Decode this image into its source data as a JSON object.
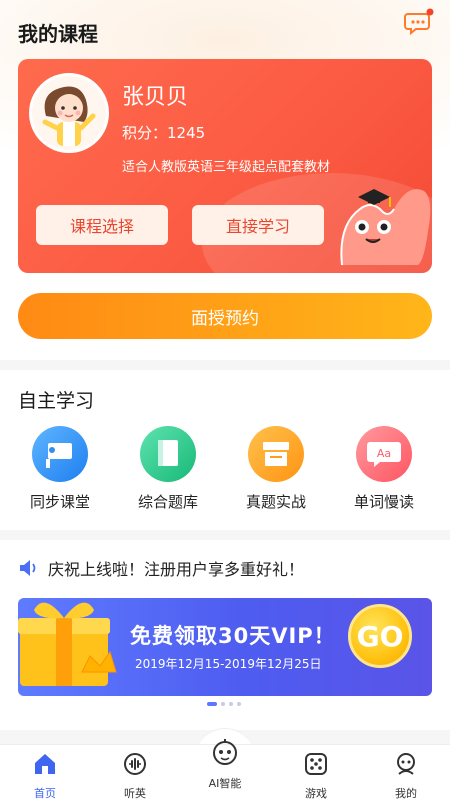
{
  "header": {
    "title": "我的课程"
  },
  "course_card": {
    "name": "张贝贝",
    "score_label": "积分：",
    "score_value": "1245",
    "textbook": "适合人教版英语三年级起点配套教材",
    "select_button": "课程选择",
    "study_button": "直接学习"
  },
  "appointment_button": "面授预约",
  "self_study": {
    "title": "自主学习",
    "items": [
      {
        "label": "同步课堂",
        "icon": "classroom-icon",
        "color": "#2f8ff5"
      },
      {
        "label": "综合题库",
        "icon": "question-bank-icon",
        "color": "#20c98a"
      },
      {
        "label": "真题实战",
        "icon": "exam-icon",
        "color": "#ff9d1a"
      },
      {
        "label": "单词慢读",
        "icon": "word-icon",
        "color": "#ff5d6a"
      }
    ]
  },
  "notice": {
    "text": "庆祝上线啦！注册用户享多重好礼！",
    "icon": "speaker-icon"
  },
  "banner": {
    "title": "免费领取30天VIP！",
    "subtitle": "2019年12月15-2019年12月25日",
    "go_label": "GO"
  },
  "tabs": [
    {
      "label": "首页",
      "icon": "home-icon",
      "active": true
    },
    {
      "label": "听英",
      "icon": "listen-icon",
      "active": false
    },
    {
      "label": "AI智能",
      "icon": "robot-icon",
      "active": false
    },
    {
      "label": "游戏",
      "icon": "dice-icon",
      "active": false
    },
    {
      "label": "我的",
      "icon": "profile-icon",
      "active": false
    }
  ],
  "colors": {
    "card": "#fb5a42",
    "accent_orange": "#ff9a17",
    "banner": "#5468f2",
    "tab_active": "#3e66f0"
  }
}
